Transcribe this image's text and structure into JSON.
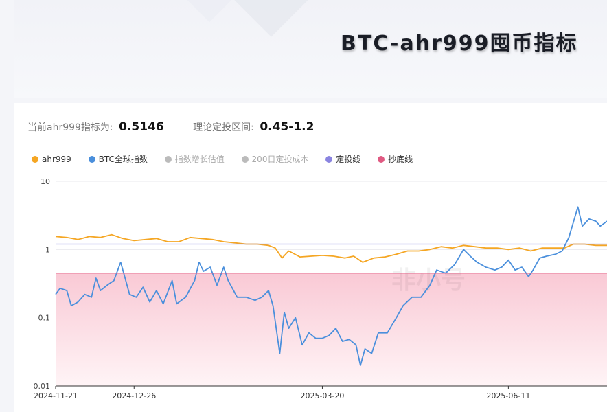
{
  "title": "BTC-ahr999囤币指标",
  "stats": {
    "current_label": "当前ahr999指标为:",
    "current_value": "0.5146",
    "range_label": "理论定投区间:",
    "range_value": "0.45-1.2"
  },
  "watermark": "非小号",
  "colors": {
    "ahr999": "#f5a623",
    "btc": "#4a8fdc",
    "dca": "#8a84e0",
    "bottom": "#e05a82",
    "disabled": "#bbbbbb"
  },
  "legend": [
    {
      "label": "ahr999",
      "color": "#f5a623",
      "active": true
    },
    {
      "label": "BTC全球指数",
      "color": "#4a8fdc",
      "active": true
    },
    {
      "label": "指数增长估值",
      "color": "#bbbbbb",
      "active": false
    },
    {
      "label": "200日定投成本",
      "color": "#bbbbbb",
      "active": false
    },
    {
      "label": "定投线",
      "color": "#8a84e0",
      "active": true
    },
    {
      "label": "抄底线",
      "color": "#e05a82",
      "active": true
    }
  ],
  "chart_data": {
    "type": "line",
    "y_scale": "log",
    "y_ticks": [
      "10",
      "1",
      "0.1",
      "0.01"
    ],
    "y_tick_values": [
      10,
      1,
      0.1,
      0.01
    ],
    "ylim": [
      0.01,
      10
    ],
    "x_ticks": [
      "2024-11-21",
      "2024-12-26",
      "2025-03-20",
      "2025-06-11"
    ],
    "xlim": [
      "2024-11-21",
      "2025-07-25"
    ],
    "reference_lines": [
      {
        "name": "定投线",
        "value": 1.2
      },
      {
        "name": "抄底线",
        "value": 0.45
      }
    ],
    "series": [
      {
        "name": "ahr999",
        "points": [
          [
            "2024-11-21",
            1.55
          ],
          [
            "2024-11-26",
            1.5
          ],
          [
            "2024-12-01",
            1.4
          ],
          [
            "2024-12-06",
            1.55
          ],
          [
            "2024-12-11",
            1.5
          ],
          [
            "2024-12-16",
            1.65
          ],
          [
            "2024-12-21",
            1.45
          ],
          [
            "2024-12-26",
            1.35
          ],
          [
            "2024-12-31",
            1.4
          ],
          [
            "2025-01-05",
            1.45
          ],
          [
            "2025-01-10",
            1.3
          ],
          [
            "2025-01-15",
            1.3
          ],
          [
            "2025-01-20",
            1.5
          ],
          [
            "2025-01-25",
            1.45
          ],
          [
            "2025-01-30",
            1.4
          ],
          [
            "2025-02-04",
            1.3
          ],
          [
            "2025-02-09",
            1.25
          ],
          [
            "2025-02-14",
            1.2
          ],
          [
            "2025-02-19",
            1.2
          ],
          [
            "2025-02-24",
            1.15
          ],
          [
            "2025-02-27",
            1.05
          ],
          [
            "2025-03-02",
            0.75
          ],
          [
            "2025-03-05",
            0.95
          ],
          [
            "2025-03-10",
            0.78
          ],
          [
            "2025-03-15",
            0.8
          ],
          [
            "2025-03-20",
            0.82
          ],
          [
            "2025-03-25",
            0.8
          ],
          [
            "2025-03-30",
            0.75
          ],
          [
            "2025-04-03",
            0.8
          ],
          [
            "2025-04-07",
            0.65
          ],
          [
            "2025-04-12",
            0.75
          ],
          [
            "2025-04-17",
            0.78
          ],
          [
            "2025-04-22",
            0.85
          ],
          [
            "2025-04-27",
            0.95
          ],
          [
            "2025-05-02",
            0.95
          ],
          [
            "2025-05-07",
            1.0
          ],
          [
            "2025-05-12",
            1.1
          ],
          [
            "2025-05-17",
            1.05
          ],
          [
            "2025-05-22",
            1.15
          ],
          [
            "2025-05-27",
            1.1
          ],
          [
            "2025-06-01",
            1.05
          ],
          [
            "2025-06-06",
            1.05
          ],
          [
            "2025-06-11",
            1.0
          ],
          [
            "2025-06-16",
            1.05
          ],
          [
            "2025-06-21",
            0.95
          ],
          [
            "2025-06-26",
            1.05
          ],
          [
            "2025-07-01",
            1.05
          ],
          [
            "2025-07-06",
            1.05
          ],
          [
            "2025-07-10",
            1.2
          ],
          [
            "2025-07-15",
            1.2
          ],
          [
            "2025-07-20",
            1.15
          ],
          [
            "2025-07-25",
            1.15
          ]
        ]
      },
      {
        "name": "BTC全球指数",
        "points": [
          [
            "2024-11-21",
            0.22
          ],
          [
            "2024-11-23",
            0.27
          ],
          [
            "2024-11-26",
            0.25
          ],
          [
            "2024-11-28",
            0.15
          ],
          [
            "2024-12-01",
            0.17
          ],
          [
            "2024-12-04",
            0.22
          ],
          [
            "2024-12-07",
            0.2
          ],
          [
            "2024-12-09",
            0.38
          ],
          [
            "2024-12-11",
            0.25
          ],
          [
            "2024-12-14",
            0.3
          ],
          [
            "2024-12-17",
            0.35
          ],
          [
            "2024-12-20",
            0.65
          ],
          [
            "2024-12-22",
            0.38
          ],
          [
            "2024-12-24",
            0.22
          ],
          [
            "2024-12-27",
            0.2
          ],
          [
            "2024-12-30",
            0.28
          ],
          [
            "2025-01-02",
            0.17
          ],
          [
            "2025-01-05",
            0.25
          ],
          [
            "2025-01-08",
            0.16
          ],
          [
            "2025-01-12",
            0.35
          ],
          [
            "2025-01-14",
            0.16
          ],
          [
            "2025-01-18",
            0.2
          ],
          [
            "2025-01-22",
            0.35
          ],
          [
            "2025-01-24",
            0.65
          ],
          [
            "2025-01-26",
            0.48
          ],
          [
            "2025-01-29",
            0.55
          ],
          [
            "2025-02-01",
            0.3
          ],
          [
            "2025-02-04",
            0.55
          ],
          [
            "2025-02-06",
            0.35
          ],
          [
            "2025-02-10",
            0.2
          ],
          [
            "2025-02-14",
            0.2
          ],
          [
            "2025-02-18",
            0.18
          ],
          [
            "2025-02-21",
            0.2
          ],
          [
            "2025-02-24",
            0.25
          ],
          [
            "2025-02-26",
            0.15
          ],
          [
            "2025-03-01",
            0.03
          ],
          [
            "2025-03-03",
            0.12
          ],
          [
            "2025-03-05",
            0.07
          ],
          [
            "2025-03-08",
            0.1
          ],
          [
            "2025-03-11",
            0.04
          ],
          [
            "2025-03-14",
            0.06
          ],
          [
            "2025-03-17",
            0.05
          ],
          [
            "2025-03-20",
            0.05
          ],
          [
            "2025-03-23",
            0.055
          ],
          [
            "2025-03-26",
            0.07
          ],
          [
            "2025-03-29",
            0.045
          ],
          [
            "2025-04-01",
            0.048
          ],
          [
            "2025-04-04",
            0.04
          ],
          [
            "2025-04-06",
            0.02
          ],
          [
            "2025-04-08",
            0.035
          ],
          [
            "2025-04-11",
            0.03
          ],
          [
            "2025-04-14",
            0.06
          ],
          [
            "2025-04-18",
            0.06
          ],
          [
            "2025-04-22",
            0.1
          ],
          [
            "2025-04-25",
            0.15
          ],
          [
            "2025-04-29",
            0.2
          ],
          [
            "2025-05-03",
            0.2
          ],
          [
            "2025-05-07",
            0.3
          ],
          [
            "2025-05-10",
            0.5
          ],
          [
            "2025-05-14",
            0.45
          ],
          [
            "2025-05-18",
            0.6
          ],
          [
            "2025-05-22",
            1.0
          ],
          [
            "2025-05-25",
            0.8
          ],
          [
            "2025-05-28",
            0.65
          ],
          [
            "2025-06-01",
            0.55
          ],
          [
            "2025-06-05",
            0.5
          ],
          [
            "2025-06-08",
            0.55
          ],
          [
            "2025-06-11",
            0.7
          ],
          [
            "2025-06-14",
            0.5
          ],
          [
            "2025-06-17",
            0.55
          ],
          [
            "2025-06-20",
            0.4
          ],
          [
            "2025-06-22",
            0.5
          ],
          [
            "2025-06-25",
            0.75
          ],
          [
            "2025-06-28",
            0.8
          ],
          [
            "2025-07-02",
            0.85
          ],
          [
            "2025-07-05",
            0.95
          ],
          [
            "2025-07-08",
            1.5
          ],
          [
            "2025-07-10",
            2.5
          ],
          [
            "2025-07-12",
            4.2
          ],
          [
            "2025-07-14",
            2.2
          ],
          [
            "2025-07-17",
            2.8
          ],
          [
            "2025-07-20",
            2.6
          ],
          [
            "2025-07-22",
            2.2
          ],
          [
            "2025-07-25",
            2.6
          ]
        ]
      }
    ]
  }
}
